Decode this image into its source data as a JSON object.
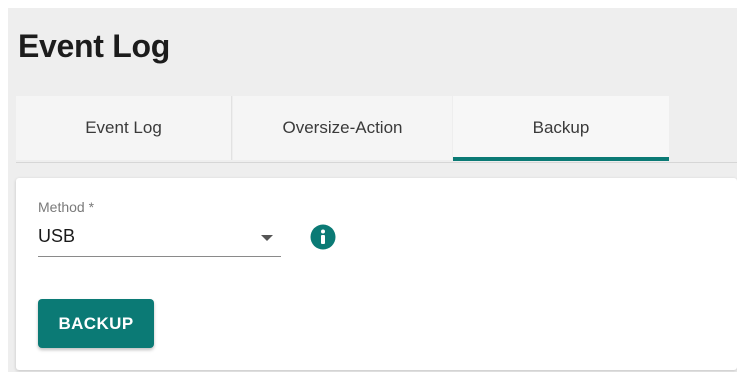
{
  "page": {
    "title": "Event Log"
  },
  "tabs": [
    {
      "label": "Event Log",
      "active": false
    },
    {
      "label": "Oversize-Action",
      "active": false
    },
    {
      "label": "Backup",
      "active": true
    }
  ],
  "form": {
    "method_label": "Method *",
    "method_value": "USB",
    "info_icon": "info-icon",
    "dropdown_icon": "chevron-down-icon"
  },
  "actions": {
    "backup_label": "BACKUP"
  },
  "colors": {
    "accent": "#0b7a75",
    "page_background": "#eeeeee",
    "card_background": "#ffffff"
  }
}
